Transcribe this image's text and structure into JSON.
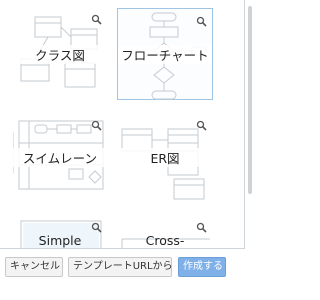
{
  "templates": [
    {
      "label": "クラス図",
      "icon": "magnify-icon"
    },
    {
      "label": "フローチャート",
      "icon": "magnify-icon",
      "selected": true
    },
    {
      "label": "スイムレーン",
      "icon": "magnify-icon"
    },
    {
      "label": "ER図",
      "icon": "magnify-icon"
    },
    {
      "label": "Simple",
      "icon": "magnify-icon"
    },
    {
      "label": "Cross-",
      "icon": "magnify-icon"
    }
  ],
  "buttons": {
    "cancel": "キャンセル",
    "from_url": "テンプレートURLから",
    "create": "作成する"
  },
  "colors": {
    "selected_border": "#9ec5e6",
    "primary_button": "#7fb0e8",
    "thumb_line": "#c5cbd2"
  }
}
